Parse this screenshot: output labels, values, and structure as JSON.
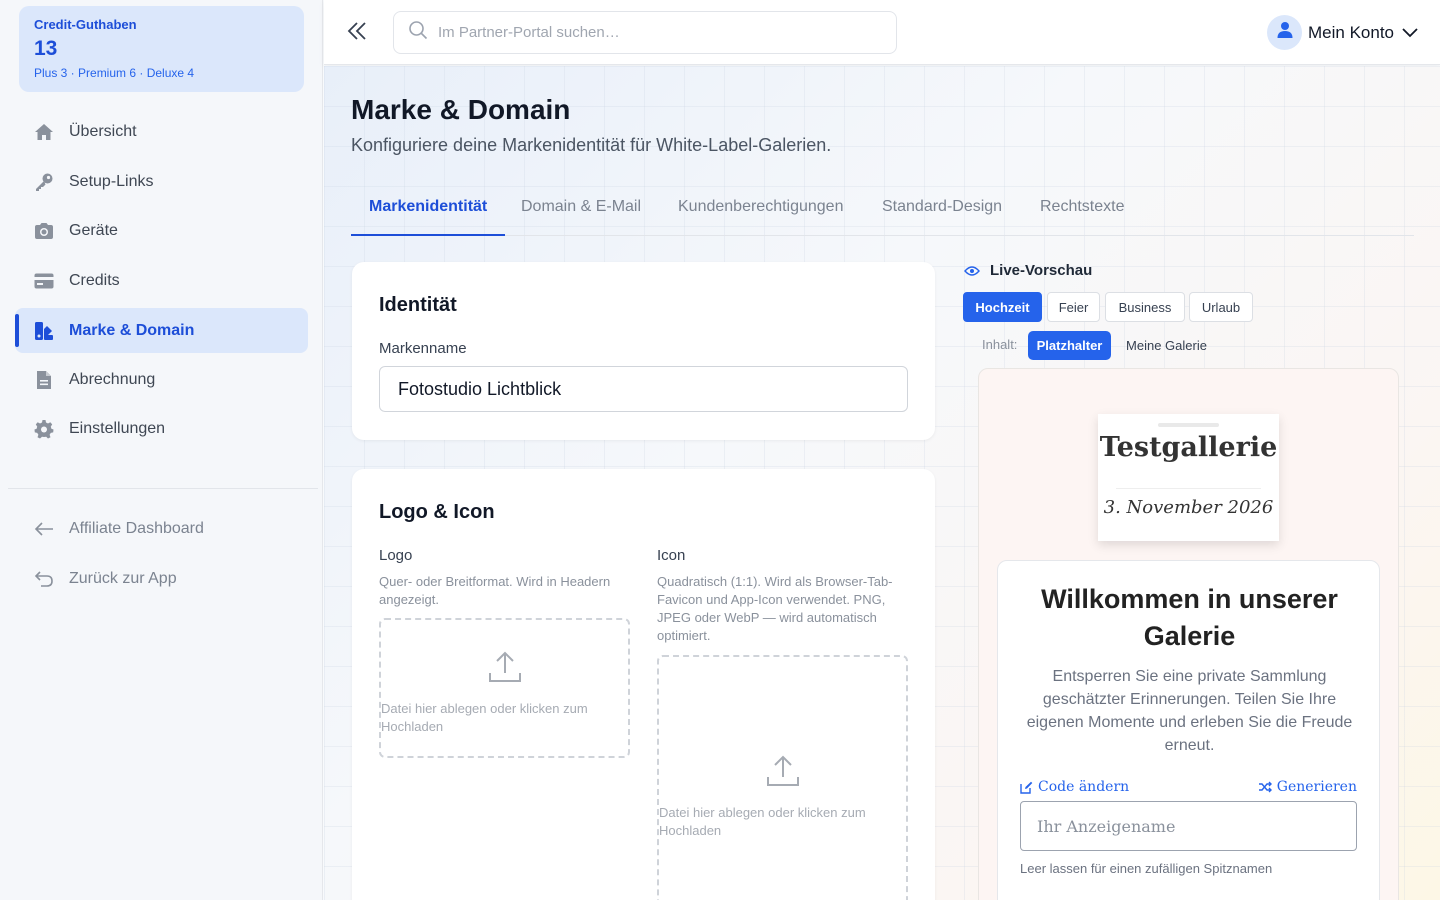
{
  "sidebar": {
    "credits": {
      "title": "Credit-Guthaben",
      "count": "13",
      "detail": "Plus 3 · Premium 6 · Deluxe 4"
    },
    "items": [
      {
        "label": "Übersicht",
        "icon": "home-icon"
      },
      {
        "label": "Setup-Links",
        "icon": "key-icon"
      },
      {
        "label": "Geräte",
        "icon": "camera-icon"
      },
      {
        "label": "Credits",
        "icon": "credit-card-icon"
      },
      {
        "label": "Marke & Domain",
        "icon": "brand-icon",
        "active": true
      },
      {
        "label": "Abrechnung",
        "icon": "invoice-icon"
      },
      {
        "label": "Einstellungen",
        "icon": "gear-icon"
      }
    ],
    "footer_items": [
      {
        "label": "Affiliate Dashboard",
        "icon": "arrow-left-icon"
      },
      {
        "label": "Zurück zur App",
        "icon": "return-icon"
      }
    ]
  },
  "topbar": {
    "search_placeholder": "Im Partner-Portal suchen…",
    "account_label": "Mein Konto"
  },
  "page": {
    "title": "Marke & Domain",
    "subtitle": "Konfiguriere deine Markenidentität für White-Label-Galerien.",
    "tabs": [
      "Markenidentität",
      "Domain & E-Mail",
      "Kundenberechtigungen",
      "Standard-Design",
      "Rechtstexte"
    ],
    "active_tab": "Markenidentität"
  },
  "identity": {
    "title": "Identität",
    "brand_label": "Markenname",
    "brand_value": "Fotostudio Lichtblick"
  },
  "logo_icon": {
    "title": "Logo & Icon",
    "logo_label": "Logo",
    "logo_help": "Quer- oder Breitformat. Wird in Headern angezeigt.",
    "icon_label": "Icon",
    "icon_help": "Quadratisch (1:1). Wird als Browser-Tab-Favicon und App-Icon verwendet. PNG, JPEG oder WebP — wird automatisch optimiert.",
    "dropzone_text": "Datei hier ablegen oder klicken zum Hochladen"
  },
  "preview": {
    "heading": "Live-Vorschau",
    "themes": [
      "Hochzeit",
      "Feier",
      "Business",
      "Urlaub"
    ],
    "active_theme": "Hochzeit",
    "content_label": "Inhalt:",
    "content_options": [
      "Platzhalter",
      "Meine Galerie"
    ],
    "active_content": "Platzhalter",
    "gallery_title": "Testgallerie",
    "gallery_date": "3. November 2026",
    "welcome_title": "Willkommen in unserer Galerie",
    "welcome_text": "Entsperren Sie eine private Sammlung geschätzter Erinnerungen. Teilen Sie Ihre eigenen Momente und erleben Sie die Freude erneut.",
    "change_code": "Code ändern",
    "generate": "Generieren",
    "name_placeholder": "Ihr Anzeigename",
    "name_help": "Leer lassen für einen zufälligen Spitznamen"
  },
  "colors": {
    "accent": "#1d4ed8",
    "accent_button": "#2563eb",
    "active_bg": "#dbe7fb"
  }
}
